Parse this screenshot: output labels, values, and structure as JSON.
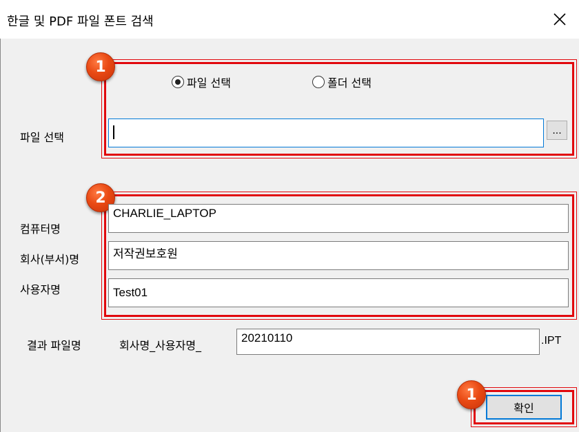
{
  "window": {
    "title": "한글 및 PDF 파일 폰트 검색",
    "close_icon": "close-icon"
  },
  "mode": {
    "options": [
      {
        "label": "파일 선택",
        "selected": true
      },
      {
        "label": "폴더 선택",
        "selected": false
      }
    ]
  },
  "file_select": {
    "label": "파일 선택",
    "value": "",
    "browse_label": "..."
  },
  "computer": {
    "label": "컴퓨터명",
    "value": "CHARLIE_LAPTOP"
  },
  "company": {
    "label": "회사(부서)명",
    "value": "저작권보호원"
  },
  "user": {
    "label": "사용자명",
    "value": "Test01"
  },
  "result": {
    "label": "결과 파일명",
    "prefix": "회사명_사용자명_",
    "value": "20210110",
    "suffix": ".IPT"
  },
  "ok_label": "확인",
  "annotations": {
    "badge1": "1",
    "badge2": "2",
    "badge3": "1"
  },
  "colors": {
    "highlight": "#e1070c",
    "badge": "#e94a14",
    "focus": "#0078d7"
  }
}
